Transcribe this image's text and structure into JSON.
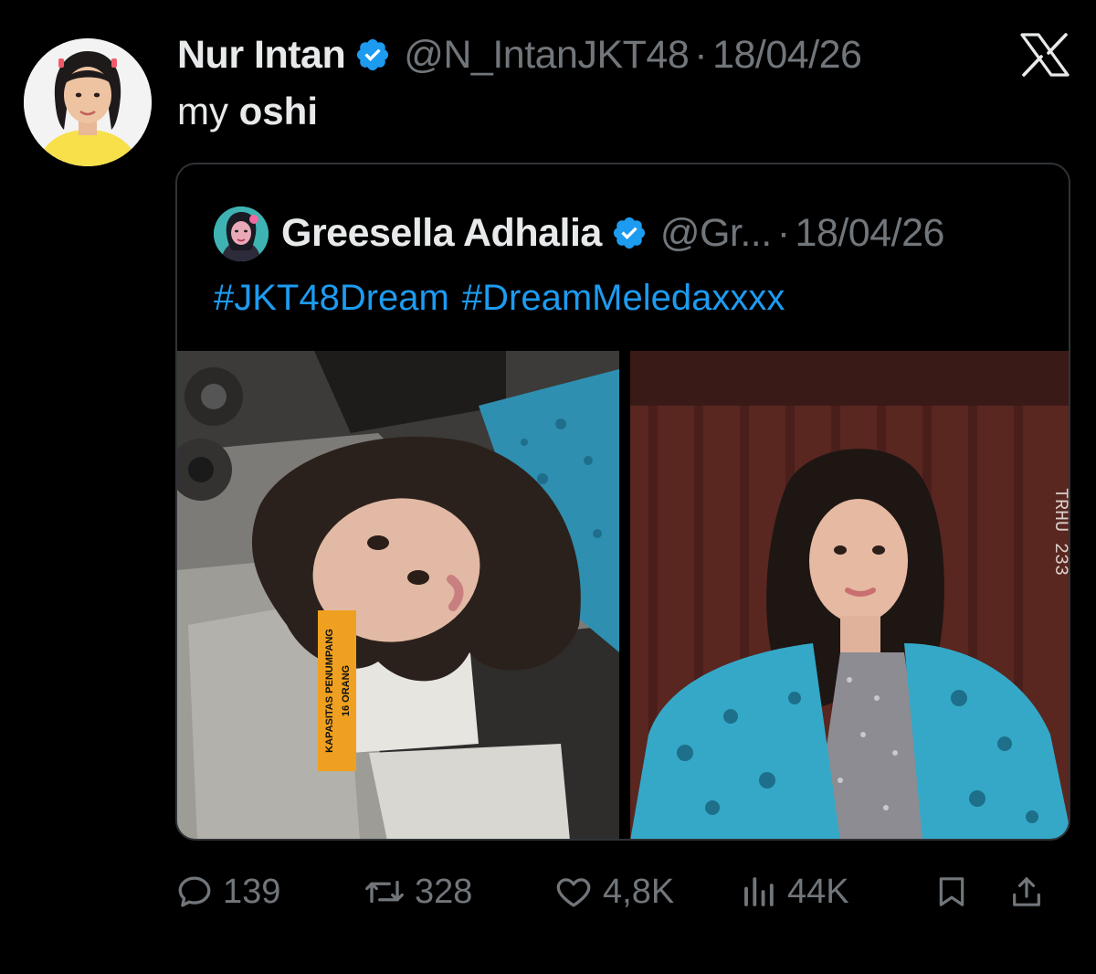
{
  "tweet": {
    "author_name": "Nur Intan",
    "handle": "@N_IntanJKT48",
    "separator": "·",
    "date": "18/04/26",
    "text_plain": "my ",
    "text_bold": "oshi"
  },
  "quoted_tweet": {
    "author_name": "Greesella Adhalia",
    "handle": "@Gr...",
    "separator": "·",
    "date": "18/04/26",
    "hashtags": [
      "#JKT48Dream",
      "#DreamMeledaxxxx"
    ],
    "photo_left": {
      "sticker_line1": "KAPASITAS PENUMPANG",
      "sticker_line2": "16 ORANG"
    },
    "photo_right": {
      "side_text": "TRHU 233"
    }
  },
  "actions": {
    "reply_count": "139",
    "retweet_count": "328",
    "like_count": "4,8K",
    "views_count": "44K"
  },
  "icons": {
    "verified": "verified-badge-icon",
    "brand": "x-logo-icon",
    "reply": "reply-icon",
    "retweet": "retweet-icon",
    "like": "heart-icon",
    "views": "views-icon",
    "bookmark": "bookmark-icon",
    "share": "share-icon"
  },
  "colors": {
    "background": "#000000",
    "text_primary": "#e7e9ea",
    "text_secondary": "#71767b",
    "accent": "#1d9bf0",
    "border": "#2f3336"
  }
}
